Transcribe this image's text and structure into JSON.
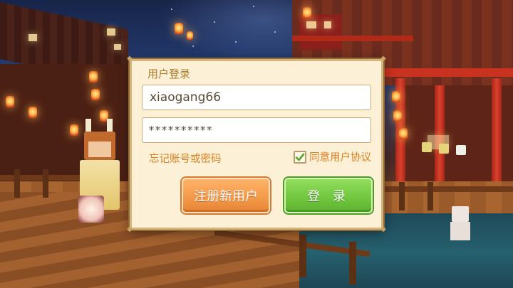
{
  "dialog": {
    "title": "用户登录",
    "username": {
      "value": "xiaogang66",
      "placeholder": ""
    },
    "password": {
      "value": "**********",
      "placeholder": ""
    },
    "forgot_link": "忘记账号或密码",
    "agreement": {
      "label": "同意用户协议",
      "checked": true
    },
    "buttons": {
      "register": "注册新用户",
      "login": "登 录"
    }
  },
  "icons": {
    "checkmark": "checkmark-icon",
    "corner": "corner-ornament-icon"
  },
  "colors": {
    "dialog_bg": "#fcf1d7",
    "dialog_border": "#d9b478",
    "title_text": "#b07a2c",
    "link_text": "#e0801f",
    "register_button": "#f59a4a",
    "login_button": "#72c83f",
    "checkmark": "#5aa52a"
  }
}
